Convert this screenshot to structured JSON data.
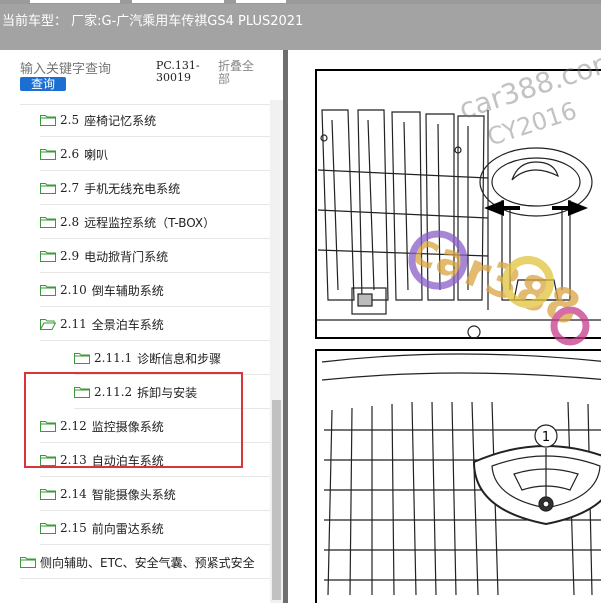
{
  "header": {
    "title": "当前车型： 厂家:G-广汽乘用车传祺GS4 PLUS2021"
  },
  "search": {
    "placeholder": "输入关键字查询",
    "button_label": "查询"
  },
  "doc_code": "PC.131-30019",
  "collapse_all_label": "折叠全部",
  "tree": {
    "items": [
      {
        "num": "2.5",
        "label": "座椅记忆系统",
        "level": 1
      },
      {
        "num": "2.6",
        "label": "喇叭",
        "level": 1
      },
      {
        "num": "2.7",
        "label": "手机无线充电系统",
        "level": 1
      },
      {
        "num": "2.8",
        "label": "远程监控系统（T-BOX）",
        "level": 1
      },
      {
        "num": "2.9",
        "label": "电动掀背门系统",
        "level": 1
      },
      {
        "num": "2.10",
        "label": "倒车辅助系统",
        "level": 1
      },
      {
        "num": "2.11",
        "label": "全景泊车系统",
        "level": 1,
        "open": true
      },
      {
        "num": "2.11.1",
        "label": "诊断信息和步骤",
        "level": 2
      },
      {
        "num": "2.11.2",
        "label": "拆卸与安装",
        "level": 2
      },
      {
        "num": "2.12",
        "label": "监控摄像系统",
        "level": 1
      },
      {
        "num": "2.13",
        "label": "自动泊车系统",
        "level": 1
      },
      {
        "num": "2.14",
        "label": "智能摄像头系统",
        "level": 1
      },
      {
        "num": "2.15",
        "label": "前向雷达系统",
        "level": 1
      },
      {
        "num": "",
        "label": "侧向辅助、ETC、安全气囊、预紧式安全",
        "level": 0
      }
    ]
  },
  "diagram": {
    "callout_number": "1",
    "watermark_text": "car388.com",
    "watermark_sub": "CY2016",
    "logo_text": "car388"
  },
  "colors": {
    "topbar": "#a3a3a3",
    "accent_blue": "#1b6fd3",
    "highlight_red": "#d9343a",
    "folder_green": "#3a9a3a"
  }
}
